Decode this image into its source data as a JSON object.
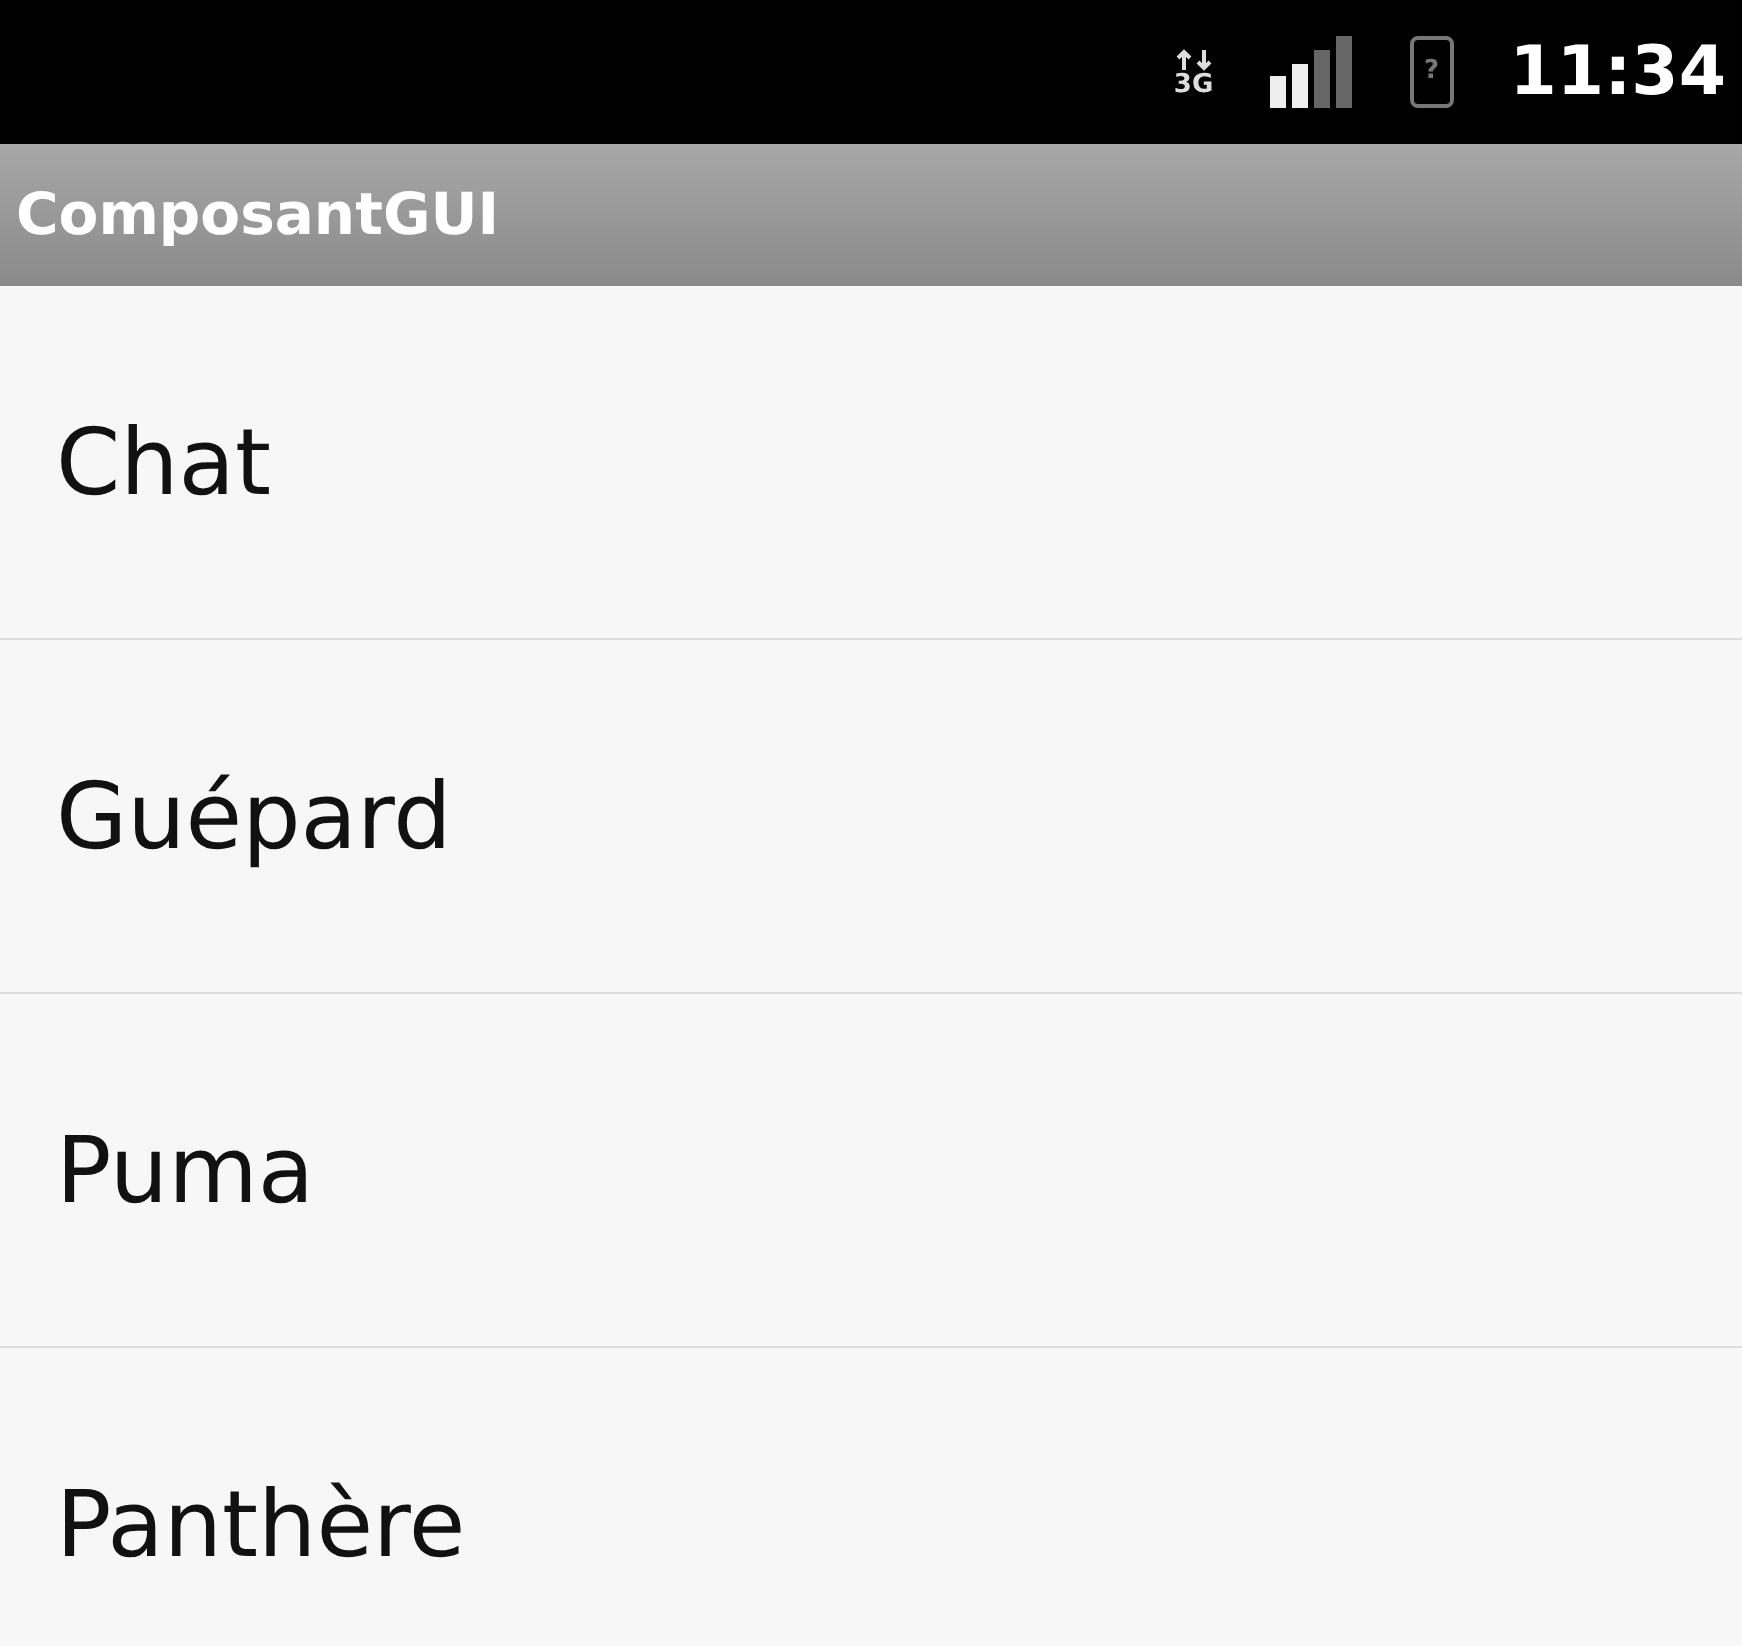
{
  "status_bar": {
    "network": "3G",
    "battery": "?",
    "time": "11:34"
  },
  "title_bar": {
    "title": "ComposantGUI"
  },
  "list": {
    "items": [
      {
        "label": "Chat"
      },
      {
        "label": "Guépard"
      },
      {
        "label": "Puma"
      },
      {
        "label": "Panthère"
      }
    ]
  }
}
